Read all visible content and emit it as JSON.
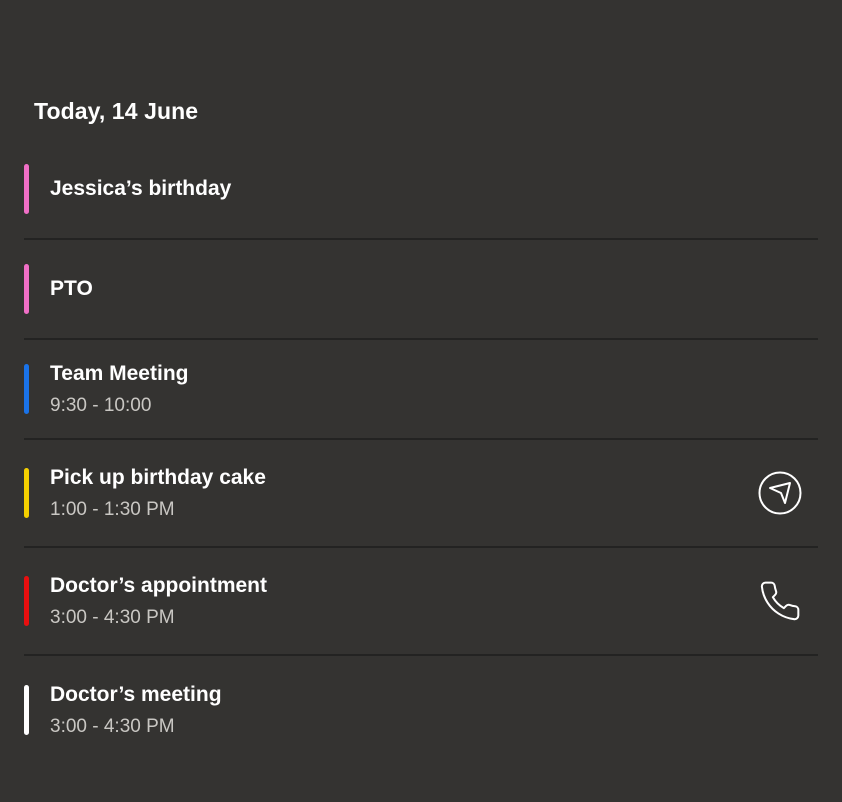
{
  "header": {
    "date_label": "Today, 14 June"
  },
  "events": [
    {
      "title": "Jessica’s birthday",
      "time": "",
      "color": "#f06fc6",
      "action_icon": ""
    },
    {
      "title": "PTO",
      "time": "",
      "color": "#f06fc6",
      "action_icon": ""
    },
    {
      "title": "Team Meeting",
      "time": "9:30 - 10:00",
      "color": "#1a73e8",
      "action_icon": ""
    },
    {
      "title": "Pick up birthday cake",
      "time": "1:00 - 1:30 PM",
      "color": "#f5d000",
      "action_icon": "navigate-icon"
    },
    {
      "title": "Doctor’s appointment",
      "time": "3:00 - 4:30 PM",
      "color": "#e80f0f",
      "action_icon": "phone-icon"
    },
    {
      "title": "Doctor’s meeting",
      "time": "3:00 - 4:30 PM",
      "color": "#ffffff",
      "action_icon": ""
    }
  ]
}
